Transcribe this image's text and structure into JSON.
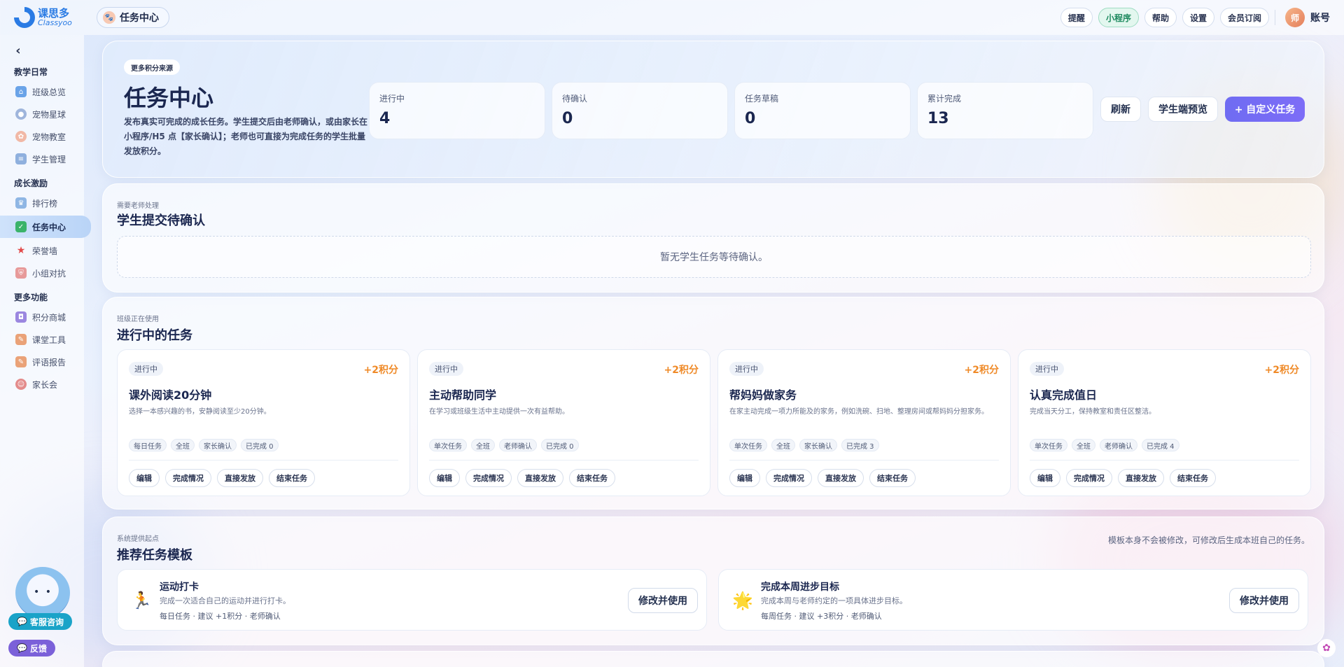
{
  "topbar": {
    "logo_cn": "课思多",
    "logo_en": "Classyoo",
    "page_chip": "任务中心",
    "buttons": [
      "提醒",
      "小程序",
      "帮助",
      "设置",
      "会员订阅"
    ],
    "avatar_text": "师",
    "account": "账号"
  },
  "sidebar": {
    "groups": [
      {
        "title": "教学日常",
        "items": [
          "班级总览",
          "宠物星球",
          "宠物教室",
          "学生管理"
        ]
      },
      {
        "title": "成长激励",
        "items": [
          "排行榜",
          "任务中心",
          "荣誉墙",
          "小组对抗"
        ]
      },
      {
        "title": "更多功能",
        "items": [
          "积分商城",
          "课堂工具",
          "评语报告",
          "家长会"
        ]
      }
    ],
    "support_label": "客服咨询",
    "feedback_label": "反馈"
  },
  "hero": {
    "tag": "更多积分来源",
    "title": "任务中心",
    "description": "发布真实可完成的成长任务。学生提交后由老师确认，或由家长在小程序/H5 点【家长确认】；老师也可直接为完成任务的学生批量发放积分。",
    "stats": [
      {
        "label": "进行中",
        "value": "4"
      },
      {
        "label": "待确认",
        "value": "0"
      },
      {
        "label": "任务草稿",
        "value": "0"
      },
      {
        "label": "累计完成",
        "value": "13"
      }
    ],
    "refresh": "刷新",
    "preview": "学生端预览",
    "custom": "+ 自定义任务"
  },
  "pending": {
    "sub": "需要老师处理",
    "title": "学生提交待确认",
    "empty": "暂无学生任务等待确认。"
  },
  "active": {
    "sub": "班级正在使用",
    "title": "进行中的任务",
    "actions": [
      "编辑",
      "完成情况",
      "直接发放",
      "结束任务"
    ],
    "tasks": [
      {
        "status": "进行中",
        "points": "+2积分",
        "title": "课外阅读20分钟",
        "desc": "选择一本感兴趣的书，安静阅读至少20分钟。",
        "meta": [
          "每日任务",
          "全班",
          "家长确认",
          "已完成 0"
        ]
      },
      {
        "status": "进行中",
        "points": "+2积分",
        "title": "主动帮助同学",
        "desc": "在学习或班级生活中主动提供一次有益帮助。",
        "meta": [
          "单次任务",
          "全班",
          "老师确认",
          "已完成 0"
        ]
      },
      {
        "status": "进行中",
        "points": "+2积分",
        "title": "帮妈妈做家务",
        "desc": "在家主动完成一项力所能及的家务，例如洗碗、扫地、整理房间或帮妈妈分担家务。",
        "meta": [
          "单次任务",
          "全班",
          "家长确认",
          "已完成 3"
        ]
      },
      {
        "status": "进行中",
        "points": "+2积分",
        "title": "认真完成值日",
        "desc": "完成当天分工，保持教室和责任区整洁。",
        "meta": [
          "单次任务",
          "全班",
          "老师确认",
          "已完成 4"
        ]
      }
    ]
  },
  "templates": {
    "sub": "系统提供起点",
    "title": "推荐任务模板",
    "note": "模板本身不会被修改，可修改后生成本班自己的任务。",
    "items": [
      {
        "icon": "🏃",
        "title": "运动打卡",
        "desc": "完成一次适合自己的运动并进行打卡。",
        "meta": "每日任务 · 建议 +1积分 · 老师确认",
        "button": "修改并使用"
      },
      {
        "icon": "🌟",
        "title": "完成本周进步目标",
        "desc": "完成本周与老师约定的一项具体进步目标。",
        "meta": "每周任务 · 建议 +3积分 · 老师确认",
        "button": "修改并使用"
      }
    ]
  }
}
